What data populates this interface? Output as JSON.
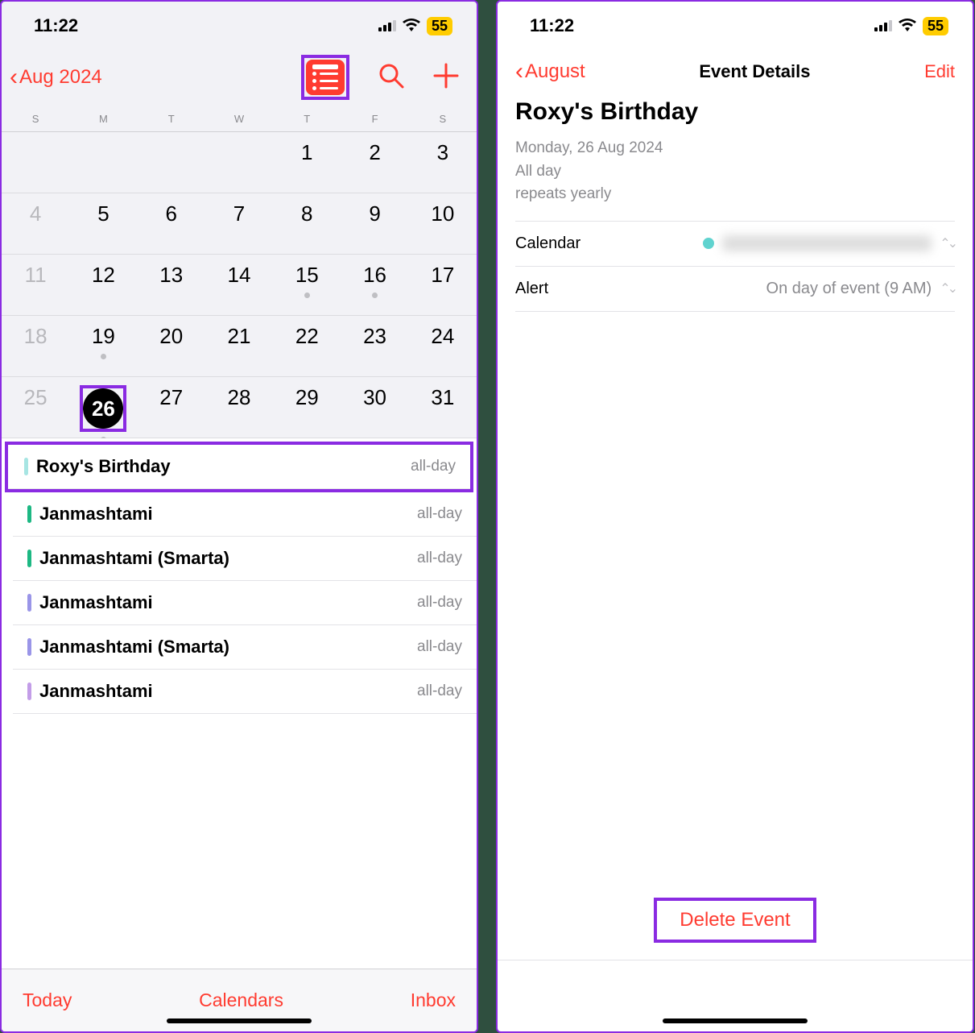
{
  "status": {
    "time": "11:22",
    "battery": "55"
  },
  "left": {
    "back_label": "Aug 2024",
    "weekdays": [
      "S",
      "M",
      "T",
      "W",
      "T",
      "F",
      "S"
    ],
    "weeks": [
      [
        {
          "n": ""
        },
        {
          "n": ""
        },
        {
          "n": ""
        },
        {
          "n": ""
        },
        {
          "n": "1"
        },
        {
          "n": "2"
        },
        {
          "n": "3"
        }
      ],
      [
        {
          "n": "4",
          "dim": true
        },
        {
          "n": "5"
        },
        {
          "n": "6"
        },
        {
          "n": "7"
        },
        {
          "n": "8"
        },
        {
          "n": "9"
        },
        {
          "n": "10"
        }
      ],
      [
        {
          "n": "11",
          "dim": true
        },
        {
          "n": "12"
        },
        {
          "n": "13"
        },
        {
          "n": "14"
        },
        {
          "n": "15",
          "dot": true
        },
        {
          "n": "16",
          "dot": true
        },
        {
          "n": "17"
        }
      ],
      [
        {
          "n": "18",
          "dim": true
        },
        {
          "n": "19",
          "dot": true
        },
        {
          "n": "20"
        },
        {
          "n": "21"
        },
        {
          "n": "22"
        },
        {
          "n": "23"
        },
        {
          "n": "24"
        }
      ],
      [
        {
          "n": "25",
          "dim": true
        },
        {
          "n": "26",
          "sel": true,
          "dot": true
        },
        {
          "n": "27"
        },
        {
          "n": "28"
        },
        {
          "n": "29"
        },
        {
          "n": "30"
        },
        {
          "n": "31"
        }
      ]
    ],
    "events": [
      {
        "title": "Roxy's Birthday",
        "time": "all-day",
        "color": "#a7e5e3",
        "hl": true
      },
      {
        "title": "Janmashtami",
        "time": "all-day",
        "color": "#1db883"
      },
      {
        "title": "Janmashtami (Smarta)",
        "time": "all-day",
        "color": "#1db883"
      },
      {
        "title": "Janmashtami",
        "time": "all-day",
        "color": "#9a95e8"
      },
      {
        "title": "Janmashtami (Smarta)",
        "time": "all-day",
        "color": "#9a95e8"
      },
      {
        "title": "Janmashtami",
        "time": "all-day",
        "color": "#c39de8"
      }
    ],
    "bottom": {
      "today": "Today",
      "calendars": "Calendars",
      "inbox": "Inbox"
    }
  },
  "right": {
    "back_label": "August",
    "title": "Event Details",
    "edit": "Edit",
    "event_title": "Roxy's Birthday",
    "date_line": "Monday, 26 Aug 2024",
    "allday_line": "All day",
    "repeat_line": "repeats yearly",
    "calendar_label": "Calendar",
    "alert_label": "Alert",
    "alert_value": "On day of event (9 AM)",
    "delete": "Delete Event"
  }
}
